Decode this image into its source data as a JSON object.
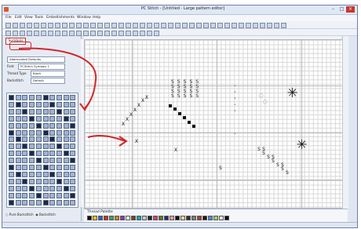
{
  "window": {
    "title": "PC Stitch - [Untitled - Large pattern editor]",
    "controls": [
      "–",
      "□",
      "×"
    ]
  },
  "menubar": [
    "File",
    "Edit",
    "View",
    "Tools",
    "Embellishments",
    "Window",
    "Help"
  ],
  "sidebar": {
    "header": "Symbols",
    "dropdown_set": "Abbreviated Defaults",
    "font_label": "Font",
    "font_value": "PCStitch Symbols 1",
    "thread_label": "Thread Type",
    "thread_value": "Black",
    "backstitch_label": "Backstitch",
    "backstitch_value": "Default",
    "radio_a": "Pure Backstitch",
    "radio_b": "Backstitch"
  },
  "stitch_glyphs": {
    "s_block": "S S S S S\nS S S S S\nS S S S S\nS S S S S",
    "x_mark": "X",
    "s_small": "S",
    "dot": "•",
    "star": "✳"
  },
  "thread_panel": {
    "label": "Thread Palette",
    "colors": [
      "#111111",
      "#e8c21a",
      "#2a62c9",
      "#d62a2a",
      "#3aa55a",
      "#e07a26",
      "#8a3ab0",
      "#f2f2f2",
      "#6a4a2a",
      "#11a2b8",
      "#c9c9c9",
      "#222222",
      "#d63a8a",
      "#5a7a1a",
      "#2a2a6a",
      "#ff9a9a",
      "#111111",
      "#e8d58a",
      "#333333",
      "#7a7a7a",
      "#b03a3a",
      "#1a1a1a",
      "#4a8ad6",
      "#a0d06a",
      "#e0e0e0",
      "#111111"
    ]
  },
  "annotations": {
    "accent": "#d3262b"
  }
}
